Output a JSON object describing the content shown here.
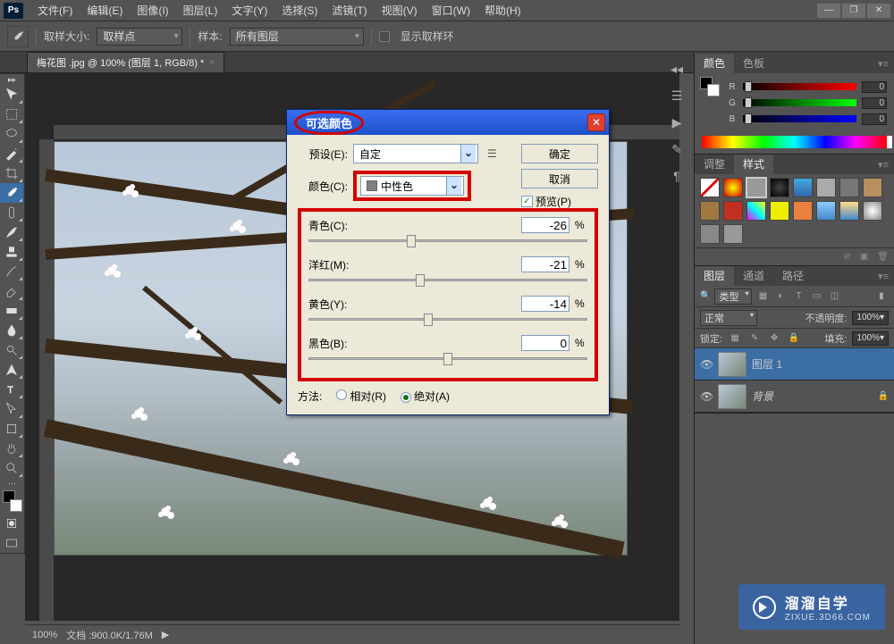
{
  "menubar": {
    "items": [
      "文件(F)",
      "编辑(E)",
      "图像(I)",
      "图层(L)",
      "文字(Y)",
      "选择(S)",
      "滤镜(T)",
      "视图(V)",
      "窗口(W)",
      "帮助(H)"
    ]
  },
  "optbar": {
    "sample_size_label": "取样大小:",
    "sample_size_value": "取样点",
    "sample_label": "样本:",
    "sample_value": "所有图层",
    "show_ring": "显示取样环"
  },
  "doc": {
    "tab": "梅花图 .jpg @ 100% (图层 1, RGB/8) *"
  },
  "status": {
    "zoom": "100%",
    "info": "文档 :900.0K/1.76M"
  },
  "color_panel": {
    "tabs": [
      "颜色",
      "色板"
    ],
    "channels": [
      {
        "ch": "R",
        "val": "0"
      },
      {
        "ch": "G",
        "val": "0"
      },
      {
        "ch": "B",
        "val": "0"
      }
    ]
  },
  "adjust_panel": {
    "tabs": [
      "调整",
      "样式"
    ]
  },
  "layers_panel": {
    "tabs": [
      "图层",
      "通道",
      "路径"
    ],
    "kind": "类型",
    "blend": "正常",
    "opacity_label": "不透明度:",
    "opacity": "100%",
    "lock_label": "锁定:",
    "fill_label": "填充:",
    "fill": "100%",
    "layers": [
      {
        "name": "图层 1",
        "locked": false,
        "selected": true
      },
      {
        "name": "背景",
        "locked": true,
        "selected": false
      }
    ]
  },
  "dialog": {
    "title": "可选颜色",
    "preset_label": "预设(E):",
    "preset_value": "自定",
    "color_label": "颜色(C):",
    "color_value": "中性色",
    "ok": "确定",
    "cancel": "取消",
    "preview": "预览(P)",
    "sliders": [
      {
        "label": "青色(C):",
        "value": "-26",
        "thumb": 37
      },
      {
        "label": "洋红(M):",
        "value": "-21",
        "thumb": 40
      },
      {
        "label": "黄色(Y):",
        "value": "-14",
        "thumb": 43
      },
      {
        "label": "黑色(B):",
        "value": "0",
        "thumb": 50
      }
    ],
    "method_label": "方法:",
    "relative": "相对(R)",
    "absolute": "绝对(A)"
  },
  "watermark": {
    "brand": "溜溜自学",
    "sub": "ZIXUE.3D66.COM"
  }
}
